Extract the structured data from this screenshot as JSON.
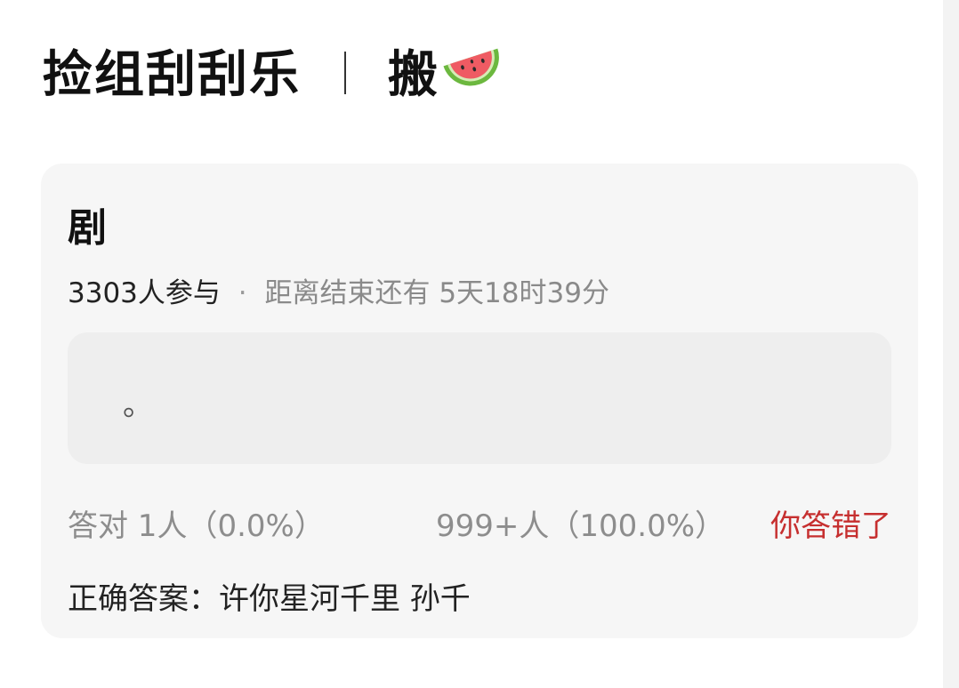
{
  "header": {
    "title": "捡组刮刮乐",
    "separator": "｜",
    "subtitle": "搬",
    "emoji_icon": "watermelon-icon"
  },
  "quiz": {
    "title": "剧",
    "participants": "3303人参与",
    "meta_dot": "·",
    "time_remaining": "距离结束还有 5天18时39分",
    "answer_placeholder": "。",
    "correct_stat": "答对  1人（0.0%）",
    "wrong_stat": "999+人（100.0%）",
    "verdict": "你答错了",
    "correct_answer": "正确答案：许你星河千里 孙千"
  },
  "colors": {
    "card_bg": "#f6f6f6",
    "answer_box_bg": "#eeeeee",
    "verdict_red": "#c62f2f",
    "muted_gray": "#8d8d8d"
  }
}
